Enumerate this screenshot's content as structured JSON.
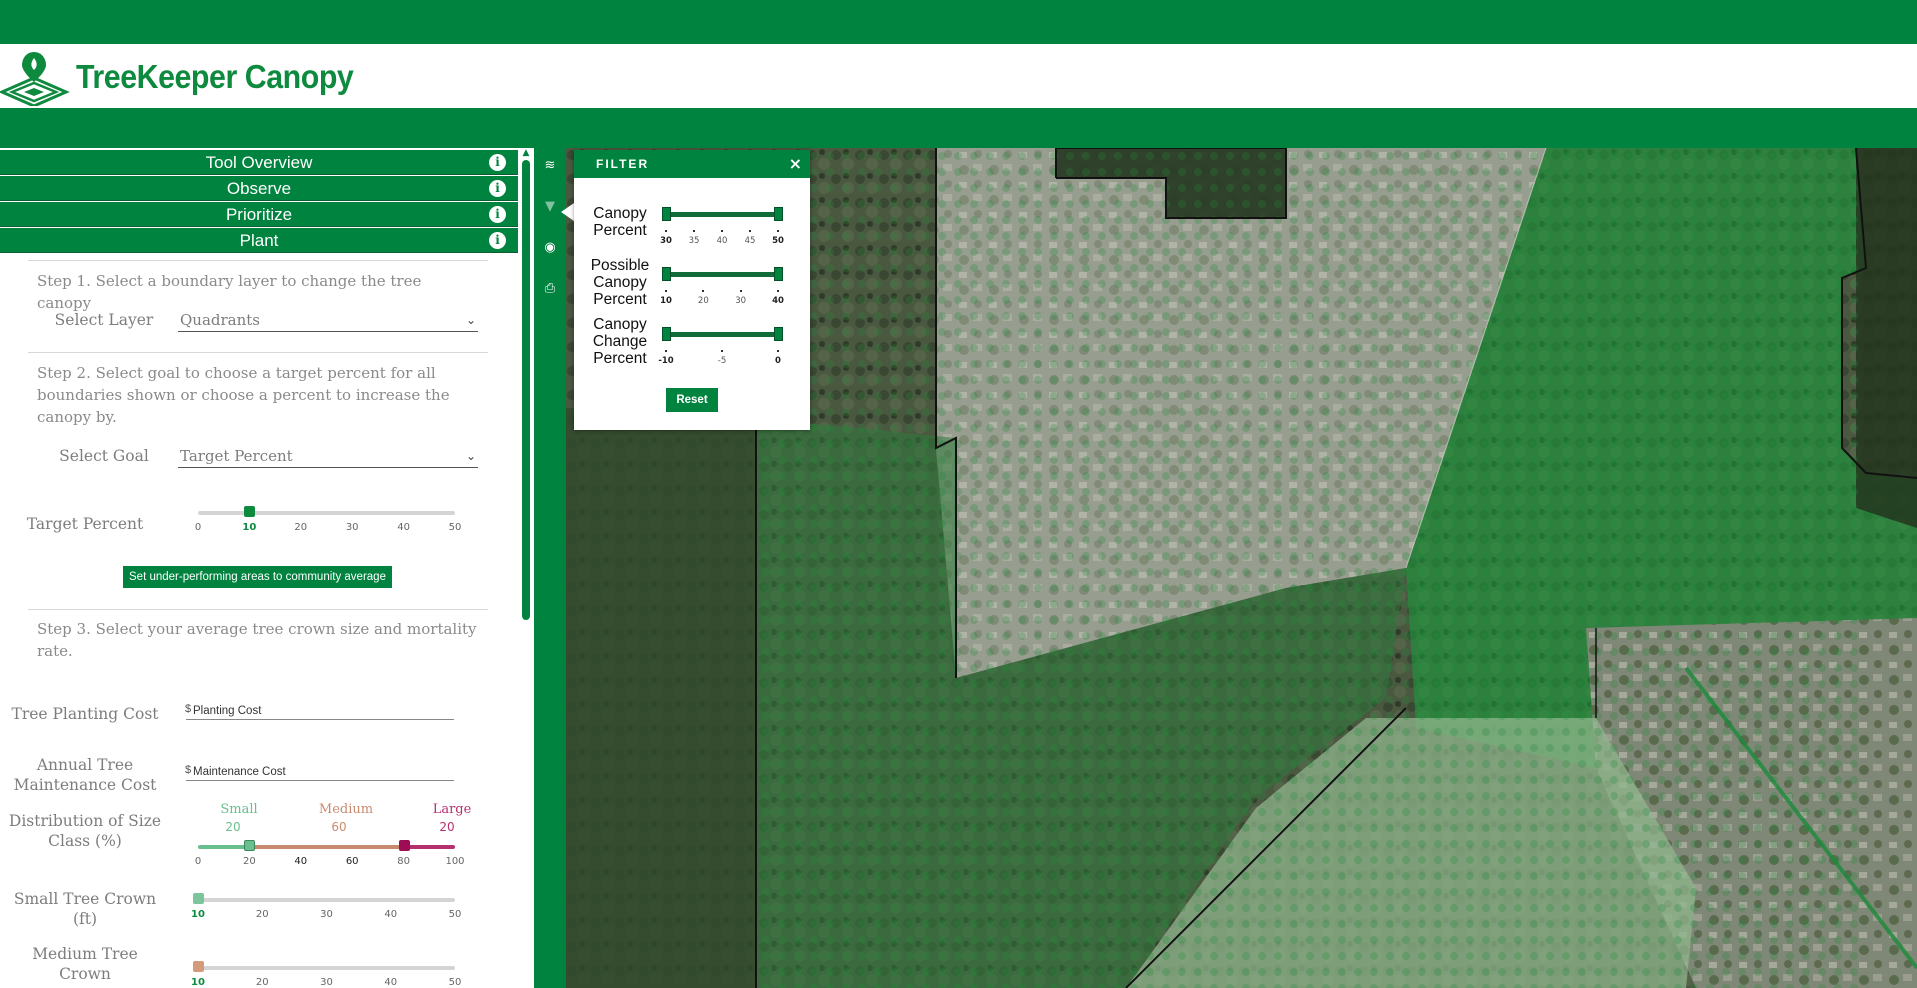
{
  "app": {
    "title": "TreeKeeper Canopy",
    "accent": "#00833e"
  },
  "accordion": [
    {
      "label": "Tool Overview"
    },
    {
      "label": "Observe"
    },
    {
      "label": "Prioritize"
    },
    {
      "label": "Plant"
    }
  ],
  "info_glyph": "i",
  "plant": {
    "step1": "Step 1. Select a boundary layer to change the tree canopy",
    "select_layer_label": "Select Layer",
    "select_layer_value": "Quadrants",
    "step2": "Step 2. Select goal to choose a target percent for all boundaries shown or choose a percent to increase the canopy by.",
    "select_goal_label": "Select Goal",
    "select_goal_value": "Target Percent",
    "target_percent_label": "Target Percent",
    "target_percent": {
      "value": 10,
      "ticks": [
        "0",
        "10",
        "20",
        "30",
        "40",
        "50"
      ]
    },
    "community_button": "Set under-performing areas to community average",
    "step3": "Step 3. Select your average tree crown size and mortality rate.",
    "planting_cost_label": "Tree Planting Cost",
    "planting_cost_placeholder": "Planting Cost",
    "maintenance_cost_label": "Annual Tree Maintenance Cost",
    "maintenance_cost_placeholder": "Maintenance Cost",
    "currency": "$",
    "distribution_label": "Distribution of Size Class (%)",
    "distribution": {
      "small": {
        "name": "Small",
        "value": "20",
        "color": "#6abf8e"
      },
      "medium": {
        "name": "Medium",
        "value": "60",
        "color": "#c98b6f"
      },
      "large": {
        "name": "Large",
        "value": "20",
        "color": "#b5306e"
      },
      "handles": [
        20,
        80
      ],
      "ticks": [
        "0",
        "20",
        "40",
        "60",
        "80",
        "100"
      ]
    },
    "small_crown_label": "Small Tree Crown (ft)",
    "small_crown": {
      "value": 10,
      "ticks": [
        "10",
        "20",
        "30",
        "40",
        "50"
      ]
    },
    "medium_crown_label": "Medium Tree Crown",
    "medium_crown": {
      "value": 10,
      "ticks": [
        "10",
        "20",
        "30",
        "40",
        "50"
      ]
    }
  },
  "filter": {
    "title": "FILTER",
    "close": "×",
    "canopy_label": "Canopy Percent",
    "canopy_ticks": [
      "30",
      "35",
      "40",
      "45",
      "50"
    ],
    "possible_label": "Possible Canopy Percent",
    "possible_ticks": [
      "10",
      "20",
      "30",
      "40"
    ],
    "change_label": "Canopy Change Percent",
    "change_ticks": [
      "-10",
      "-5",
      "0"
    ],
    "reset": "Reset"
  },
  "map_tools": [
    {
      "icon": "layers-icon",
      "glyph": "≋"
    },
    {
      "icon": "filter-icon",
      "glyph": "▼"
    },
    {
      "icon": "target-icon",
      "glyph": "◉"
    },
    {
      "icon": "print-icon",
      "glyph": "⎙"
    }
  ]
}
